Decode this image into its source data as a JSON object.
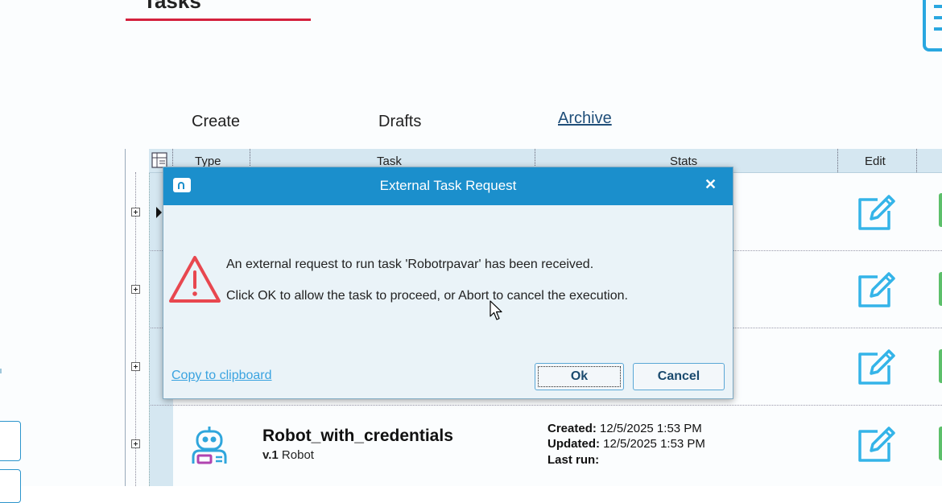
{
  "page": {
    "title": "Tasks"
  },
  "tabs": [
    {
      "label": "Create"
    },
    {
      "label": "Drafts"
    },
    {
      "label": "Archive"
    }
  ],
  "grid": {
    "columns": [
      "Type",
      "Task",
      "Stats",
      "Edit"
    ],
    "visible_row": {
      "name": "Robot_with_credentials",
      "version_prefix": "v.1",
      "version_type": "Robot",
      "created_label": "Created:",
      "created_value": "12/5/2025 1:53 PM",
      "updated_label": "Updated:",
      "updated_value": "12/5/2025 1:53 PM",
      "last_run_label": "Last run:"
    }
  },
  "dialog": {
    "title": "External Task Request",
    "close_glyph": "✕",
    "line1": "An external request to run task 'Robotrpavar' has been received.",
    "line2": "Click OK to allow the task to proceed, or Abort to cancel the execution.",
    "copy_link": "Copy to clipboard",
    "ok_label": "Ok",
    "cancel_label": "Cancel"
  },
  "colors": {
    "accent": "#1b8fcc",
    "title_underline": "#d4213d",
    "warning": "#e8474f",
    "icon_blue": "#29a7e0",
    "status_green": "#5cbf6a"
  },
  "icons": [
    "document-icon",
    "row-selector-icon",
    "expand-icon",
    "edit-icon",
    "robot-icon",
    "app-icon",
    "close-icon",
    "warning-icon",
    "mouse-cursor-icon"
  ]
}
